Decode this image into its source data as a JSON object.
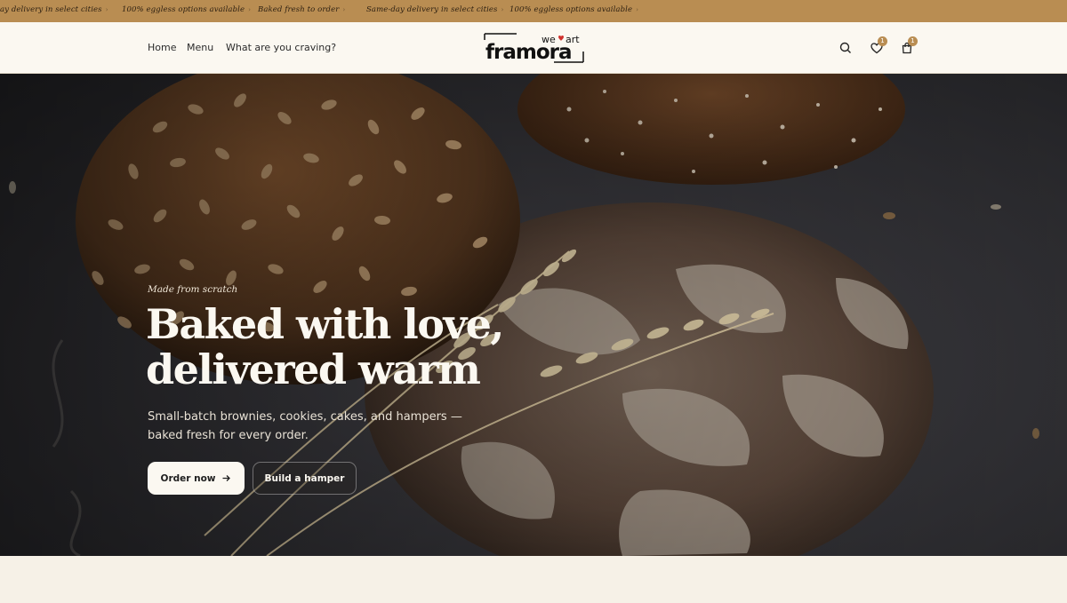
{
  "announcement": {
    "items": [
      "ay delivery in select cities",
      "100% eggless options available",
      "Baked fresh to order",
      "Same-day delivery in select cities",
      "100% eggless options available"
    ]
  },
  "nav": {
    "links": [
      "Home",
      "Menu",
      "What are you craving?"
    ]
  },
  "logo": {
    "word": "framora",
    "tagline_we": "we",
    "tagline_art": "art"
  },
  "header_icons": {
    "search": "search-icon",
    "wishlist": "heart-icon",
    "wishlist_count": "1",
    "cart": "bag-icon",
    "cart_count": "1"
  },
  "hero": {
    "eyebrow": "Made from scratch",
    "headline_line1": "Baked with love,",
    "headline_line2": "delivered warm",
    "subtext": "Small-batch brownies, cookies, cakes, and hampers — baked fresh for every order.",
    "primary_cta": "Order now",
    "secondary_cta": "Build a hamper"
  },
  "colors": {
    "announcement_bg": "#b98d52",
    "header_bg": "#fbf8f1",
    "page_bg": "#f6f1e7",
    "accent_heart": "#d0312d"
  }
}
